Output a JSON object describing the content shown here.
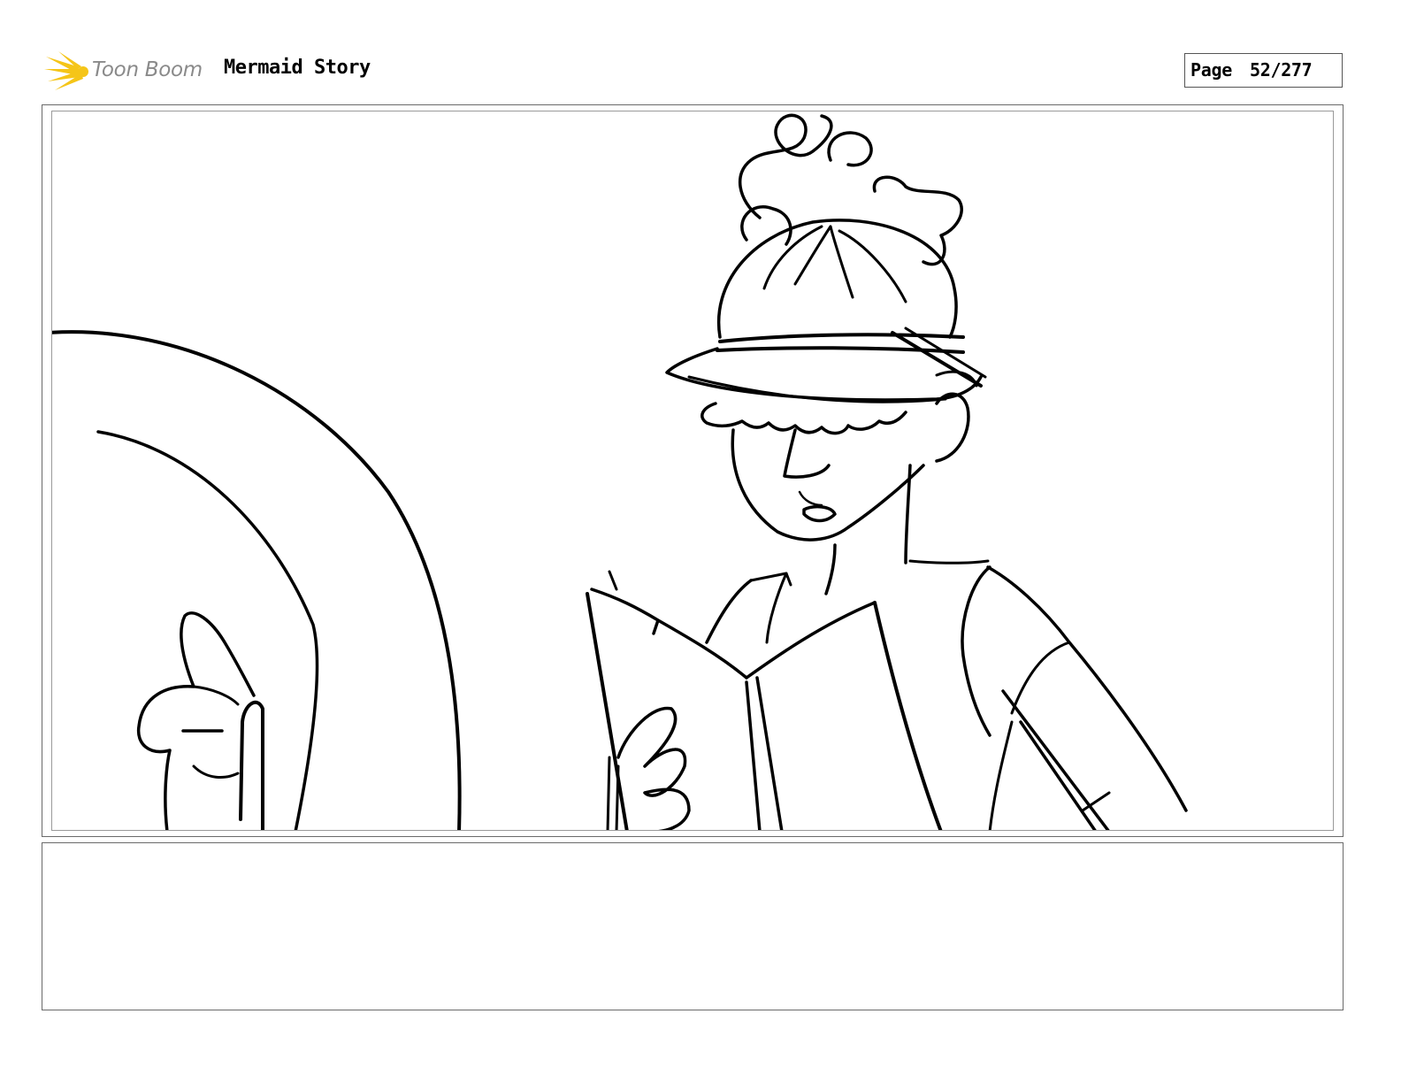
{
  "header": {
    "logo_text": "Toon Boom",
    "project_title": "Mermaid Story",
    "page_label": "Page",
    "page_number": "52/277"
  },
  "colors": {
    "logo_burst": "#f5c518",
    "logo_text": "#8a8a8a",
    "ink": "#000000",
    "frame_border": "#6a6a6a"
  },
  "panel": {
    "drawing": "storyboard sketch"
  },
  "notes": {
    "text": ""
  }
}
